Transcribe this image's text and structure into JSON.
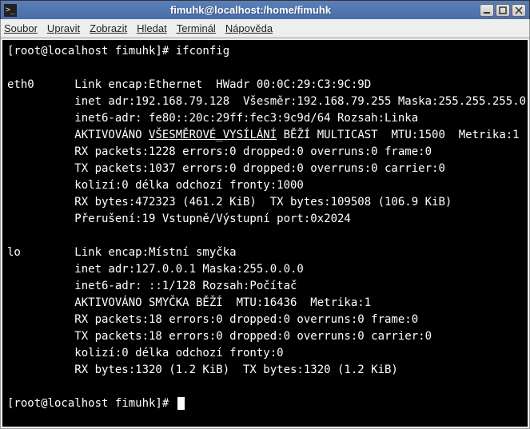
{
  "window": {
    "title": "fimuhk@localhost:/home/fimuhk"
  },
  "menu": {
    "soubor": "Soubor",
    "upravit": "Upravit",
    "zobrazit": "Zobrazit",
    "hledat": "Hledat",
    "terminal": "Terminál",
    "napoveda": "Nápověda"
  },
  "terminal": {
    "prompt1": "[root@localhost fimuhk]# ",
    "cmd1": "ifconfig",
    "lines": [
      "",
      "eth0      Link encap:Ethernet  HWadr 00:0C:29:C3:9C:9D",
      "          inet adr:192.168.79.128  Všesměr:192.168.79.255 Maska:255.255.255.0",
      "          inet6-adr: fe80::20c:29ff:fec3:9c9d/64 Rozsah:Linka",
      "          AKTIVOVÁNO VŠESMĚROVÉ_VYSÍLÁNÍ BĚŽÍ MULTICAST  MTU:1500  Metrika:1",
      "          RX packets:1228 errors:0 dropped:0 overruns:0 frame:0",
      "          TX packets:1037 errors:0 dropped:0 overruns:0 carrier:0",
      "          kolizí:0 délka odchozí fronty:1000",
      "          RX bytes:472323 (461.2 KiB)  TX bytes:109508 (106.9 KiB)",
      "          Přerušení:19 Vstupně/Výstupní port:0x2024",
      "",
      "lo        Link encap:Místní smyčka",
      "          inet adr:127.0.0.1 Maska:255.0.0.0",
      "          inet6-adr: ::1/128 Rozsah:Počítač",
      "          AKTIVOVÁNO SMYČKA BĚŽÍ  MTU:16436  Metrika:1",
      "          RX packets:18 errors:0 dropped:0 overruns:0 frame:0",
      "          TX packets:18 errors:0 dropped:0 overruns:0 carrier:0",
      "          kolizí:0 délka odchozí fronty:0",
      "          RX bytes:1320 (1.2 KiB)  TX bytes:1320 (1.2 KiB)",
      ""
    ],
    "prompt2": "[root@localhost fimuhk]# "
  }
}
